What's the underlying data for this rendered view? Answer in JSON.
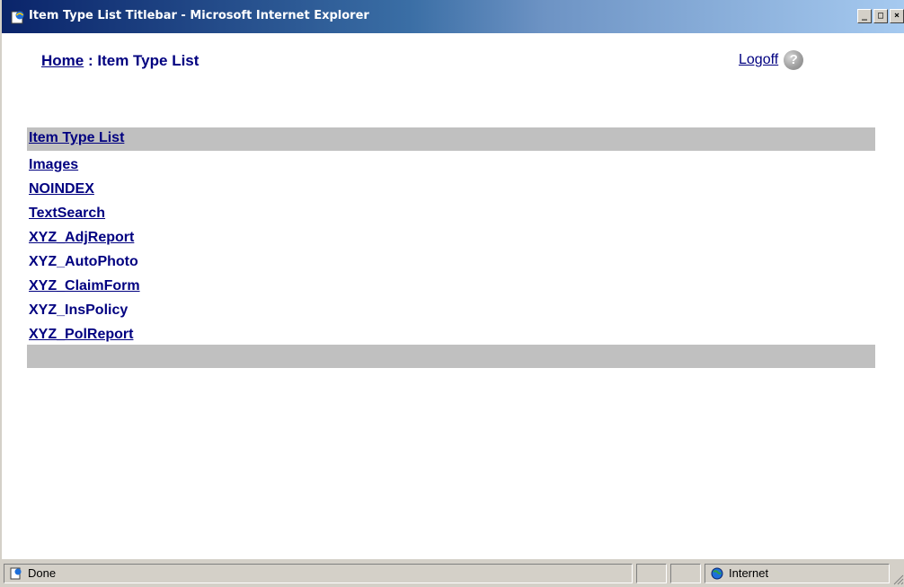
{
  "window": {
    "title": "Item Type List Titlebar - Microsoft Internet Explorer",
    "minimize_label": "_",
    "maximize_label": "□",
    "close_label": "×"
  },
  "header": {
    "home_link": "Home",
    "separator": ":",
    "current_page": "Item Type List",
    "logoff_link": "Logoff",
    "help_symbol": "?"
  },
  "list": {
    "header_label": "Item Type List",
    "items": [
      {
        "label": "Images",
        "link": true
      },
      {
        "label": "NOINDEX",
        "link": true
      },
      {
        "label": "TextSearch",
        "link": true
      },
      {
        "label": "XYZ_AdjReport",
        "link": true
      },
      {
        "label": "XYZ_AutoPhoto",
        "link": false
      },
      {
        "label": "XYZ_ClaimForm",
        "link": true
      },
      {
        "label": "XYZ_InsPolicy",
        "link": false
      },
      {
        "label": "XYZ_PolReport",
        "link": true
      }
    ]
  },
  "statusbar": {
    "status_text": "Done",
    "zone_text": "Internet"
  },
  "colors": {
    "titlebar_start": "#0a246a",
    "link": "#000080",
    "list_band": "#c0c0c0",
    "chrome": "#d4d0c8"
  }
}
